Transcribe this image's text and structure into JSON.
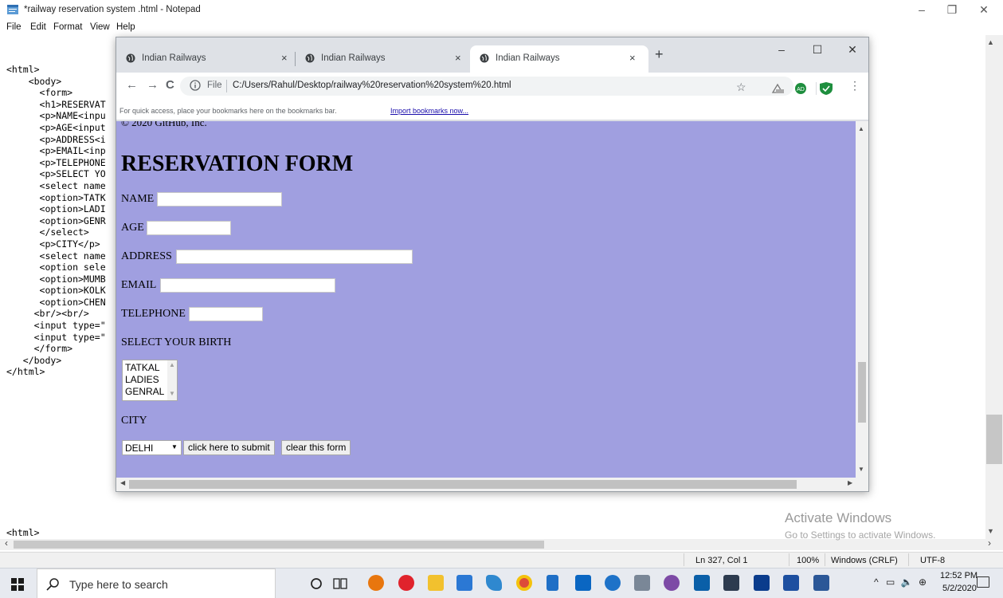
{
  "notepad": {
    "title": "*railway reservation system .html - Notepad",
    "menu": [
      "File",
      "Edit",
      "Format",
      "View",
      "Help"
    ],
    "controls": {
      "minimize": "–",
      "maximize": "❐",
      "close": "✕"
    },
    "code_lines": [
      "<html>",
      "    <body>",
      "      <form>",
      "      <h1>RESERVAT",
      "      <p>NAME<inpu",
      "      <p>AGE<input",
      "      <p>ADDRESS<i",
      "      <p>EMAIL<inp",
      "      <p>TELEPHONE",
      "      <p>SELECT YO",
      "      <select name",
      "      <option>TATK",
      "      <option>LADI",
      "      <option>GENR",
      "      </select>",
      "      <p>CITY</p>",
      "      <select name",
      "      <option sele",
      "      <option>MUMB",
      "      <option>KOLK",
      "      <option>CHEN",
      "     <br/><br/>",
      "     <input type=\"",
      "     <input type=\"",
      "     </form>",
      "   </body>",
      "</html>"
    ],
    "last_line": "<html>",
    "status": {
      "position": "Ln 327, Col 1",
      "zoom": "100%",
      "line_ending": "Windows (CRLF)",
      "encoding": "UTF-8"
    }
  },
  "watermark": {
    "title": "Activate Windows",
    "subtitle": "Go to Settings to activate Windows."
  },
  "chrome": {
    "tabs": [
      {
        "title": "Indian Railways",
        "active": false
      },
      {
        "title": "Indian Railways",
        "active": false
      },
      {
        "title": "Indian Railways",
        "active": true
      }
    ],
    "tab_close": "×",
    "new_tab": "+",
    "controls": {
      "minimize": "–",
      "maximize": "☐",
      "close": "✕"
    },
    "nav": {
      "back": "←",
      "forward": "→",
      "reload": "C"
    },
    "url_scheme": "File",
    "url": "C:/Users/Rahul/Desktop/railway%20reservation%20system%20.html",
    "star": "☆",
    "extension_badge": "AD",
    "menu": "⋮",
    "bookmarks_text": "For quick access, place your bookmarks here on the bookmarks bar.",
    "bookmarks_link": "Import bookmarks now..."
  },
  "page": {
    "copyright": "© 2020 GitHub, Inc.",
    "heading": "RESERVATION FORM",
    "fields": {
      "name": "NAME",
      "age": "AGE",
      "address": "ADDRESS",
      "email": "EMAIL",
      "telephone": "TELEPHONE"
    },
    "birth_label": "SELECT YOUR BIRTH",
    "birth_options": [
      "TATKAL",
      "LADIES",
      "GENRAL"
    ],
    "city_label": "CITY",
    "city_selected": "DELHI",
    "submit_label": "click here to submit",
    "clear_label": "clear this form",
    "bg_color": "#a09fe0"
  },
  "taskbar": {
    "search_placeholder": "Type here to search",
    "tray_arrow": "^",
    "time": "12:52 PM",
    "date": "5/2/2020"
  }
}
